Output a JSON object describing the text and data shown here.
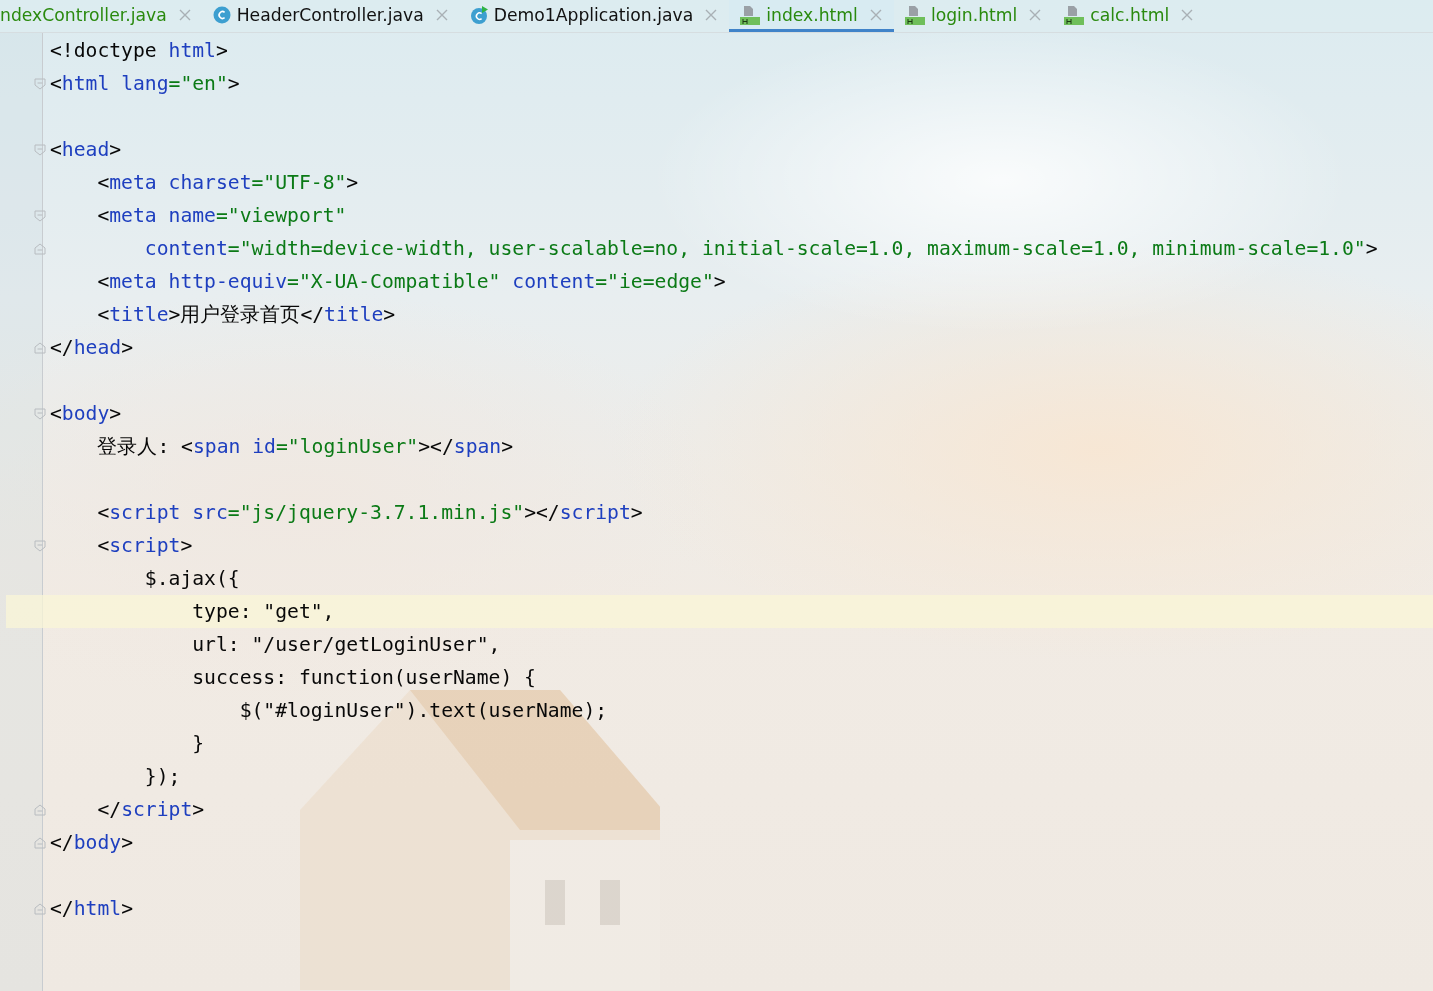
{
  "tabs": [
    {
      "label": "ndexController.java",
      "kind": "partial",
      "color": "#2a8a0e",
      "selected": false
    },
    {
      "label": "HeaderController.java",
      "kind": "class",
      "color": "#111111",
      "selected": false
    },
    {
      "label": "Demo1Application.java",
      "kind": "app",
      "color": "#111111",
      "selected": false
    },
    {
      "label": "index.html",
      "kind": "html",
      "color": "#2a8a0e",
      "selected": true
    },
    {
      "label": "login.html",
      "kind": "html",
      "color": "#2a8a0e",
      "selected": false
    },
    {
      "label": "calc.html",
      "kind": "html",
      "color": "#2a8a0e",
      "selected": false
    }
  ],
  "editor": {
    "lines": [
      {
        "kind": "plain",
        "current": false,
        "tokens": [
          {
            "kind": "text",
            "text": "<!doctype "
          },
          {
            "kind": "tag",
            "text": "html"
          },
          {
            "kind": "text",
            "text": ">"
          }
        ]
      },
      {
        "kind": "fold-start",
        "current": false,
        "tokens": [
          {
            "kind": "text",
            "text": "<"
          },
          {
            "kind": "tag",
            "text": "html"
          },
          {
            "kind": "attr",
            "text": " lang"
          },
          {
            "kind": "str",
            "text": "=\"en\""
          },
          {
            "kind": "text",
            "text": ">"
          }
        ]
      },
      {
        "kind": "plain",
        "current": false
      },
      {
        "kind": "fold-start",
        "current": false,
        "tokens": [
          {
            "kind": "text",
            "text": "<"
          },
          {
            "kind": "tag",
            "text": "head"
          },
          {
            "kind": "text",
            "text": ">"
          }
        ]
      },
      {
        "kind": "plain",
        "current": false,
        "tokens": [
          {
            "kind": "text",
            "text": "    <"
          },
          {
            "kind": "tag",
            "text": "meta"
          },
          {
            "kind": "attr",
            "text": " charset"
          },
          {
            "kind": "str",
            "text": "=\"UTF-8\""
          },
          {
            "kind": "text",
            "text": ">"
          }
        ]
      },
      {
        "kind": "fold-start",
        "current": false,
        "tokens": [
          {
            "kind": "text",
            "text": "    <"
          },
          {
            "kind": "tag",
            "text": "meta"
          },
          {
            "kind": "attr",
            "text": " name"
          },
          {
            "kind": "str",
            "text": "=\"viewport\""
          }
        ]
      },
      {
        "kind": "fold-end",
        "current": false,
        "tokens": [
          {
            "kind": "attr",
            "text": "        content"
          },
          {
            "kind": "str",
            "text": "=\"width=device-width, user-scalable=no, initial-scale=1.0, maximum-scale=1.0, minimum-scale=1.0\""
          },
          {
            "kind": "text",
            "text": ">"
          }
        ]
      },
      {
        "kind": "plain",
        "current": false,
        "tokens": [
          {
            "kind": "text",
            "text": "    <"
          },
          {
            "kind": "tag",
            "text": "meta"
          },
          {
            "kind": "attr",
            "text": " http-equiv"
          },
          {
            "kind": "str",
            "text": "=\"X-UA-Compatible\""
          },
          {
            "kind": "attr",
            "text": " content"
          },
          {
            "kind": "str",
            "text": "=\"ie=edge\""
          },
          {
            "kind": "text",
            "text": ">"
          }
        ]
      },
      {
        "kind": "plain",
        "current": false,
        "tokens": [
          {
            "kind": "text",
            "text": "    <"
          },
          {
            "kind": "tag",
            "text": "title"
          },
          {
            "kind": "text",
            "text": ">用户登录首页</"
          },
          {
            "kind": "tag",
            "text": "title"
          },
          {
            "kind": "text",
            "text": ">"
          }
        ]
      },
      {
        "kind": "fold-end",
        "current": false,
        "tokens": [
          {
            "kind": "text",
            "text": "</"
          },
          {
            "kind": "tag",
            "text": "head"
          },
          {
            "kind": "text",
            "text": ">"
          }
        ]
      },
      {
        "kind": "plain",
        "current": false
      },
      {
        "kind": "fold-start",
        "current": false,
        "tokens": [
          {
            "kind": "text",
            "text": "<"
          },
          {
            "kind": "tag",
            "text": "body"
          },
          {
            "kind": "text",
            "text": ">"
          }
        ]
      },
      {
        "kind": "plain",
        "current": false,
        "tokens": [
          {
            "kind": "text",
            "text": "    登录人: <"
          },
          {
            "kind": "tag",
            "text": "span"
          },
          {
            "kind": "attr",
            "text": " id"
          },
          {
            "kind": "str",
            "text": "=\"loginUser\""
          },
          {
            "kind": "text",
            "text": "></"
          },
          {
            "kind": "tag",
            "text": "span"
          },
          {
            "kind": "text",
            "text": ">"
          }
        ]
      },
      {
        "kind": "plain",
        "current": false
      },
      {
        "kind": "plain",
        "current": false,
        "tokens": [
          {
            "kind": "text",
            "text": "    <"
          },
          {
            "kind": "tag",
            "text": "script"
          },
          {
            "kind": "attr",
            "text": " src"
          },
          {
            "kind": "str",
            "text": "=\"js/jquery-3.7.1.min.js\""
          },
          {
            "kind": "text",
            "text": "></"
          },
          {
            "kind": "tag",
            "text": "script"
          },
          {
            "kind": "text",
            "text": ">"
          }
        ]
      },
      {
        "kind": "fold-start",
        "current": false,
        "tokens": [
          {
            "kind": "text",
            "text": "    <"
          },
          {
            "kind": "tag",
            "text": "script"
          },
          {
            "kind": "text",
            "text": ">"
          }
        ]
      },
      {
        "kind": "plain",
        "current": false,
        "tokens": [
          {
            "kind": "text",
            "text": "        $.ajax({"
          }
        ]
      },
      {
        "kind": "plain",
        "current": true,
        "tokens": [
          {
            "kind": "text",
            "text": "            type: \"get\","
          }
        ]
      },
      {
        "kind": "plain",
        "current": false,
        "tokens": [
          {
            "kind": "text",
            "text": "            url: \"/user/getLoginUser\","
          }
        ]
      },
      {
        "kind": "plain",
        "current": false,
        "tokens": [
          {
            "kind": "text",
            "text": "            success: function(userName) {"
          }
        ]
      },
      {
        "kind": "plain",
        "current": false,
        "tokens": [
          {
            "kind": "text",
            "text": "                $(\"#loginUser\").text(userName);"
          }
        ]
      },
      {
        "kind": "plain",
        "current": false,
        "tokens": [
          {
            "kind": "text",
            "text": "            }"
          }
        ]
      },
      {
        "kind": "plain",
        "current": false,
        "tokens": [
          {
            "kind": "text",
            "text": "        });"
          }
        ]
      },
      {
        "kind": "fold-end",
        "current": false,
        "tokens": [
          {
            "kind": "text",
            "text": "    </"
          },
          {
            "kind": "tag",
            "text": "script"
          },
          {
            "kind": "text",
            "text": ">"
          }
        ]
      },
      {
        "kind": "fold-end",
        "current": false,
        "tokens": [
          {
            "kind": "text",
            "text": "</"
          },
          {
            "kind": "tag",
            "text": "body"
          },
          {
            "kind": "text",
            "text": ">"
          }
        ]
      },
      {
        "kind": "plain",
        "current": false
      },
      {
        "kind": "fold-end",
        "current": false,
        "tokens": [
          {
            "kind": "text",
            "text": "</"
          },
          {
            "kind": "tag",
            "text": "html"
          },
          {
            "kind": "text",
            "text": ">"
          }
        ]
      }
    ]
  }
}
